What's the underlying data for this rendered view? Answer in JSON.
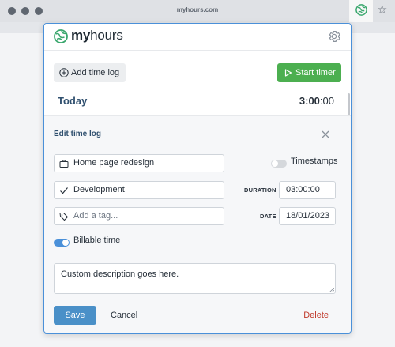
{
  "browser": {
    "url": "myhours.com",
    "extension_icon": "globe-icon",
    "bookmark_icon": "star-icon"
  },
  "header": {
    "brand_prefix": "my",
    "brand_suffix": "hours",
    "settings_icon": "gear-icon"
  },
  "toolbar": {
    "add_label": "Add time log",
    "start_label": "Start timer"
  },
  "summary": {
    "day_label": "Today",
    "total_hm": "3:00",
    "total_sec": ":00"
  },
  "edit": {
    "title": "Edit time log",
    "project": "Home page redesign",
    "task": "Development",
    "tag_placeholder": "Add a tag...",
    "duration_label": "DURATION",
    "duration": "03:00:00",
    "date_label": "DATE",
    "date": "18/01/2023",
    "timestamps_label": "Timestamps",
    "timestamps_on": false,
    "billable_label": "Billable time",
    "billable_on": true,
    "description": "Custom description goes here.",
    "save_label": "Save",
    "cancel_label": "Cancel",
    "delete_label": "Delete"
  },
  "colors": {
    "accent": "#4a90d9",
    "start_green": "#4caf50",
    "delete_red": "#c0392b",
    "heading_blue": "#30506f"
  }
}
